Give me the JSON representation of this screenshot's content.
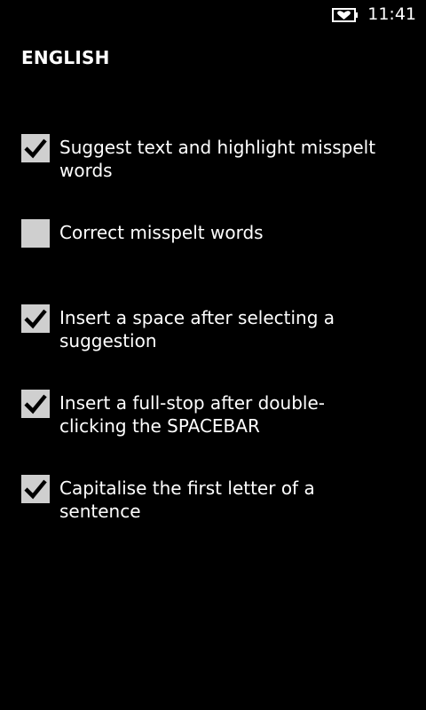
{
  "status_bar": {
    "time": "11:41",
    "battery_icon": "battery-saver-heart-icon"
  },
  "page": {
    "title": "ENGLISH"
  },
  "options": [
    {
      "label": "Suggest text and highlight misspelt\nwords",
      "checked": true
    },
    {
      "label": "Correct misspelt words",
      "checked": false
    },
    {
      "label": "Insert a space after selecting a\nsuggestion",
      "checked": true
    },
    {
      "label": "Insert a full-stop after double-\nclicking the SPACEBAR",
      "checked": true
    },
    {
      "label": "Capitalise the first letter of a\nsentence",
      "checked": true
    }
  ],
  "colors": {
    "background": "#000000",
    "text": "#ffffff",
    "checkbox_fill": "#cfcfcf",
    "checkmark": "#000000"
  }
}
